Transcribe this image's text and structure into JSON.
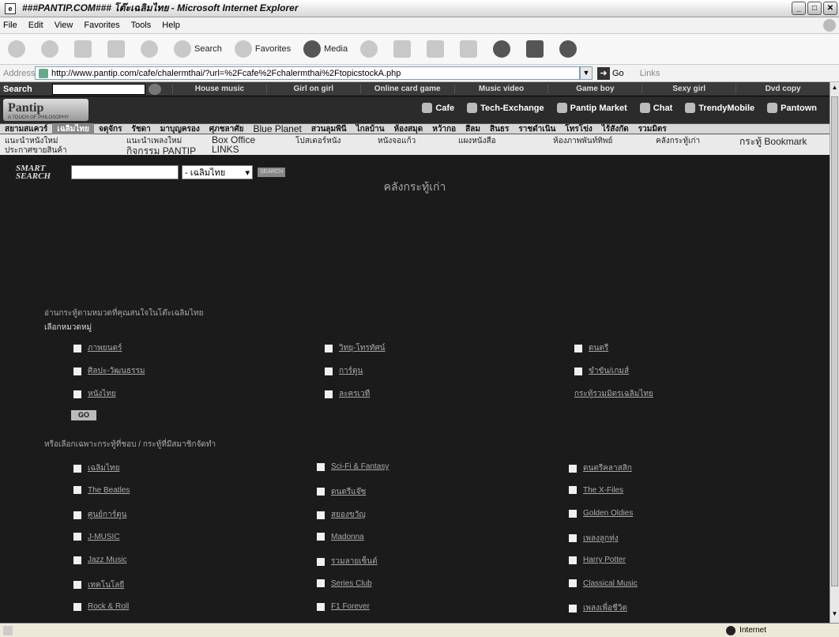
{
  "window": {
    "title": "###PANTIP.COM### โต๊ะเฉลิมไทย - Microsoft Internet Explorer"
  },
  "menu": [
    "File",
    "Edit",
    "View",
    "Favorites",
    "Tools",
    "Help"
  ],
  "toolbar": {
    "search": "Search",
    "favorites": "Favorites",
    "media": "Media"
  },
  "address": {
    "label": "Address",
    "url": "http://www.pantip.com/cafe/chalermthai/?url=%2Fcafe%2Fchalermthai%2FtopicstockA.php",
    "go": "Go",
    "links": "Links"
  },
  "site": {
    "search_label": "Search",
    "categories": [
      "House music",
      "Girl on girl",
      "Online card game",
      "Music video",
      "Game boy",
      "Sexy girl",
      "Dvd copy"
    ],
    "logo": "Pantip",
    "logo_tag": "A TOUCH OF PHILOSOPHY",
    "nav": [
      "Cafe",
      "Tech-Exchange",
      "Pantip Market",
      "Chat",
      "TrendyMobile",
      "Pantown"
    ],
    "rooms": [
      "สยามสแควร์",
      "เฉลิมไทย",
      "จตุจักร",
      "รัชดา",
      "มาบุญครอง",
      "ศุภชลาศัย",
      "Blue Planet",
      "สวนลุมพินี",
      "ไกลบ้าน",
      "ห้องสมุด",
      "หว้ากอ",
      "สีลม",
      "สินธร",
      "ราชดำเนิน",
      "โทรโข่ง",
      "ไร้สังกัด",
      "รวมมิตร"
    ],
    "subnav_row1": [
      "แนะนำหนังใหม่",
      "แนะนำเพลงใหม่",
      "Box Office",
      "โปสเตอร์หนัง",
      "หนังจอแก้ว",
      "แผงหนังสือ",
      "ห้องภาพพันท์ทิพย์",
      "คลังกระทู้เก่า",
      "กระทู้ Bookmark"
    ],
    "subnav_row2": [
      "ประกาศขายสินค้า",
      "กิจกรรม PANTIP",
      "LINKS"
    ],
    "smart_search": {
      "logo": "SMART SEARCH",
      "select": "- เฉลิมไทย",
      "button": "SEARCH"
    }
  },
  "page": {
    "title": "คลังกระทู้เก่า",
    "intro": "อ่านกระทู้ตามหมวดที่คุณสนใจในโต๊ะเฉลิมไทย",
    "section1_label": "เลือกหมวดหมู่",
    "section1": [
      [
        "ภาพยนตร์",
        "วิทยุ-โทรทัศน์",
        "ดนตรี"
      ],
      [
        "ศิลปะ-วัฒนธรรม",
        "การ์ตูน",
        "ขำขัน/เกมส์"
      ],
      [
        "หนังไทย",
        "ละครเวที",
        "กระทู้รวมมิตรเฉลิมไทย"
      ]
    ],
    "go": "GO",
    "section2_label": "หรือเลือกเฉพาะกระทู้ที่ชอบ / กระทู้ที่มีสมาชิกจัดทำ",
    "section2": [
      [
        "เฉลิมไทย",
        "Sci-Fi & Fantasy",
        "ดนตรีคลาสสิก"
      ],
      [
        "The Beatles",
        "ดนตรีแจ๊ซ",
        "The X-Files"
      ],
      [
        "ศูนย์การ์ตูน",
        "สยองขวัญ",
        "Golden Oldies"
      ],
      [
        "J-MUSIC",
        "Madonna",
        "เพลงลูกทุ่ง"
      ],
      [
        "Jazz Music",
        "รวมลายเซ็นต์",
        "Harry Potter"
      ],
      [
        "เทคโนโลยี",
        "Series Club",
        "Classical Music"
      ],
      [
        "Rock & Roll",
        "F1 Forever",
        "เพลงเพื่อชีวิต"
      ]
    ]
  },
  "status": {
    "zone": "Internet"
  }
}
